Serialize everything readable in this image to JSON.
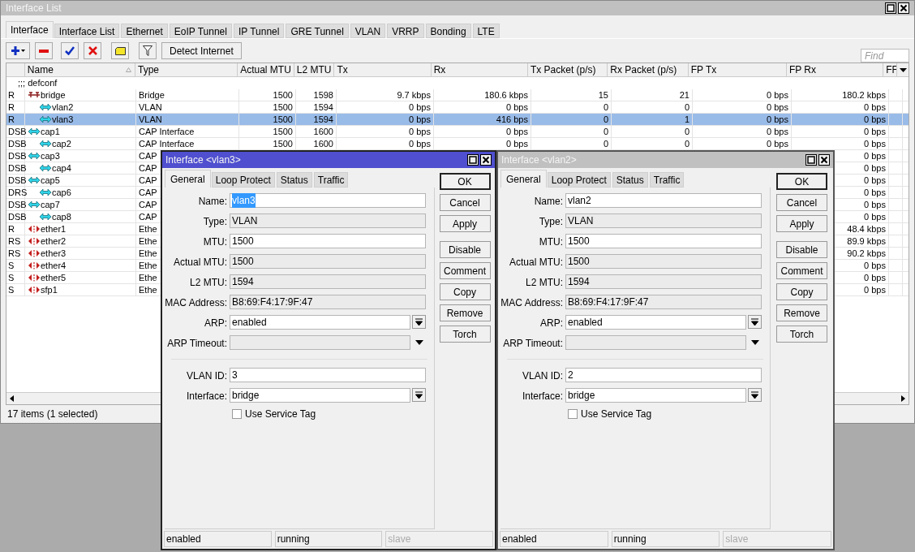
{
  "window": {
    "title": "Interface List",
    "tabs": [
      {
        "label": "Interface",
        "selected": true
      },
      {
        "label": "Interface List",
        "selected": false
      },
      {
        "label": "Ethernet",
        "selected": false
      },
      {
        "label": "EoIP Tunnel",
        "selected": false
      },
      {
        "label": "IP Tunnel",
        "selected": false
      },
      {
        "label": "GRE Tunnel",
        "selected": false
      },
      {
        "label": "VLAN",
        "selected": false
      },
      {
        "label": "VRRP",
        "selected": false
      },
      {
        "label": "Bonding",
        "selected": false
      },
      {
        "label": "LTE",
        "selected": false
      }
    ],
    "toolbar": {
      "detect_button": "Detect Internet",
      "find_placeholder": "Find"
    },
    "table": {
      "columns": [
        {
          "label": "Name"
        },
        {
          "label": "Type"
        },
        {
          "label": "Actual MTU"
        },
        {
          "label": "L2 MTU"
        },
        {
          "label": "Tx"
        },
        {
          "label": "Rx"
        },
        {
          "label": "Tx Packet (p/s)"
        },
        {
          "label": "Rx Packet (p/s)"
        },
        {
          "label": "FP Tx"
        },
        {
          "label": "FP Rx"
        },
        {
          "label": "FF"
        }
      ],
      "comment": ";;; defconf",
      "rows": [
        {
          "flags": "R",
          "name": "bridge",
          "kind": "bridge",
          "selected": false,
          "type": "Bridge",
          "actual_mtu": "1500",
          "l2_mtu": "1598",
          "tx": "9.7 kbps",
          "rx": "180.6 kbps",
          "tx_packet": "15",
          "rx_packet": "21",
          "fp_tx": "0 bps",
          "fp_rx": "180.2 kbps",
          "children": [
            {
              "flags": "R",
              "name": "vlan2",
              "kind": "wireless",
              "selected": false,
              "type": "VLAN",
              "actual_mtu": "1500",
              "l2_mtu": "1594",
              "tx": "0 bps",
              "rx": "0 bps",
              "tx_packet": "0",
              "rx_packet": "0",
              "fp_tx": "0 bps",
              "fp_rx": "0 bps"
            },
            {
              "flags": "R",
              "name": "vlan3",
              "kind": "wireless",
              "selected": true,
              "type": "VLAN",
              "actual_mtu": "1500",
              "l2_mtu": "1594",
              "tx": "0 bps",
              "rx": "416 bps",
              "tx_packet": "0",
              "rx_packet": "1",
              "fp_tx": "0 bps",
              "fp_rx": "0 bps"
            }
          ]
        },
        {
          "flags": "DSB",
          "name": "cap1",
          "kind": "wireless",
          "selected": false,
          "type": "CAP Interface",
          "actual_mtu": "1500",
          "l2_mtu": "1600",
          "tx": "0 bps",
          "rx": "0 bps",
          "tx_packet": "0",
          "rx_packet": "0",
          "fp_tx": "0 bps",
          "fp_rx": "0 bps",
          "children": [
            {
              "flags": "DSB",
              "name": "cap2",
              "kind": "wireless",
              "selected": false,
              "type": "CAP Interface",
              "actual_mtu": "1500",
              "l2_mtu": "1600",
              "tx": "0 bps",
              "rx": "0 bps",
              "tx_packet": "0",
              "rx_packet": "0",
              "fp_tx": "0 bps",
              "fp_rx": "0 bps"
            }
          ]
        },
        {
          "flags": "DSB",
          "name": "cap3",
          "kind": "wireless",
          "selected": false,
          "type": "CAP",
          "fp_rx": "0 bps",
          "children": [
            {
              "flags": "DSB",
              "name": "cap4",
              "kind": "wireless",
              "selected": false,
              "type": "CAP",
              "fp_rx": "0 bps"
            }
          ]
        },
        {
          "flags": "DSB",
          "name": "cap5",
          "kind": "wireless",
          "selected": false,
          "type": "CAP",
          "fp_rx": "0 bps",
          "children": [
            {
              "flags": "DRS",
              "name": "cap6",
              "kind": "wireless",
              "selected": false,
              "type": "CAP",
              "fp_rx": "0 bps"
            }
          ]
        },
        {
          "flags": "DSB",
          "name": "cap7",
          "kind": "wireless",
          "selected": false,
          "type": "CAP",
          "fp_rx": "0 bps",
          "children": [
            {
              "flags": "DSB",
              "name": "cap8",
              "kind": "wireless",
              "selected": false,
              "type": "CAP",
              "fp_rx": "0 bps"
            }
          ]
        },
        {
          "flags": "R",
          "name": "ether1",
          "kind": "ethernet",
          "selected": false,
          "type": "Ethe",
          "fp_rx": "48.4 kbps"
        },
        {
          "flags": "RS",
          "name": "ether2",
          "kind": "ethernet",
          "selected": false,
          "type": "Ethe",
          "fp_rx": "89.9 kbps"
        },
        {
          "flags": "RS",
          "name": "ether3",
          "kind": "ethernet",
          "selected": false,
          "type": "Ethe",
          "fp_rx": "90.2 kbps"
        },
        {
          "flags": "S",
          "name": "ether4",
          "kind": "ethernet",
          "selected": false,
          "type": "Ethe",
          "fp_rx": "0 bps"
        },
        {
          "flags": "S",
          "name": "ether5",
          "kind": "ethernet",
          "selected": false,
          "type": "Ethe",
          "fp_rx": "0 bps"
        },
        {
          "flags": "S",
          "name": "sfp1",
          "kind": "ethernet",
          "selected": false,
          "type": "Ethe",
          "fp_rx": "0 bps"
        }
      ]
    },
    "status": "17 items (1 selected)"
  },
  "dialogs": [
    {
      "title": "Interface <vlan3>",
      "active": true,
      "tabs": [
        {
          "label": "General",
          "selected": true
        },
        {
          "label": "Loop Protect",
          "selected": false
        },
        {
          "label": "Status",
          "selected": false
        },
        {
          "label": "Traffic",
          "selected": false
        }
      ],
      "sections": [
        [
          {
            "label": "Name:",
            "value": "vlan3",
            "kind": "text",
            "text_selected": true
          },
          {
            "label": "Type:",
            "value": "VLAN",
            "kind": "readonly"
          },
          {
            "label": "MTU:",
            "value": "1500",
            "kind": "text"
          },
          {
            "label": "Actual MTU:",
            "value": "1500",
            "kind": "readonly"
          },
          {
            "label": "L2 MTU:",
            "value": "1594",
            "kind": "readonly"
          },
          {
            "label": "MAC Address:",
            "value": "B8:69:F4:17:9F:47",
            "kind": "readonly"
          },
          {
            "label": "ARP:",
            "value": "enabled",
            "kind": "select"
          },
          {
            "label": "ARP Timeout:",
            "kind": "readonly_select"
          }
        ],
        [
          {
            "label": "VLAN ID:",
            "value": "3",
            "kind": "text"
          },
          {
            "label": "Interface:",
            "value": "bridge",
            "kind": "select"
          }
        ]
      ],
      "checkbox": {
        "label": "Use Service Tag",
        "checked": false
      },
      "buttons": [
        "OK",
        "Cancel",
        "Apply",
        "Disable",
        "Comment",
        "Copy",
        "Remove",
        "Torch"
      ],
      "status": [
        {
          "text": "enabled",
          "disabled": false
        },
        {
          "text": "running",
          "disabled": false
        },
        {
          "text": "slave",
          "disabled": true
        }
      ]
    },
    {
      "title": "Interface <vlan2>",
      "active": false,
      "tabs": [
        {
          "label": "General",
          "selected": true
        },
        {
          "label": "Loop Protect",
          "selected": false
        },
        {
          "label": "Status",
          "selected": false
        },
        {
          "label": "Traffic",
          "selected": false
        }
      ],
      "sections": [
        [
          {
            "label": "Name:",
            "value": "vlan2",
            "kind": "text",
            "text_selected": false
          },
          {
            "label": "Type:",
            "value": "VLAN",
            "kind": "readonly"
          },
          {
            "label": "MTU:",
            "value": "1500",
            "kind": "text"
          },
          {
            "label": "Actual MTU:",
            "value": "1500",
            "kind": "readonly"
          },
          {
            "label": "L2 MTU:",
            "value": "1594",
            "kind": "readonly"
          },
          {
            "label": "MAC Address:",
            "value": "B8:69:F4:17:9F:47",
            "kind": "readonly"
          },
          {
            "label": "ARP:",
            "value": "enabled",
            "kind": "select"
          },
          {
            "label": "ARP Timeout:",
            "kind": "readonly_select"
          }
        ],
        [
          {
            "label": "VLAN ID:",
            "value": "2",
            "kind": "text"
          },
          {
            "label": "Interface:",
            "value": "bridge",
            "kind": "select"
          }
        ]
      ],
      "checkbox": {
        "label": "Use Service Tag",
        "checked": false
      },
      "buttons": [
        "OK",
        "Cancel",
        "Apply",
        "Disable",
        "Comment",
        "Copy",
        "Remove",
        "Torch"
      ],
      "status": [
        {
          "text": "enabled",
          "disabled": false
        },
        {
          "text": "running",
          "disabled": false
        },
        {
          "text": "slave",
          "disabled": true
        }
      ]
    }
  ]
}
